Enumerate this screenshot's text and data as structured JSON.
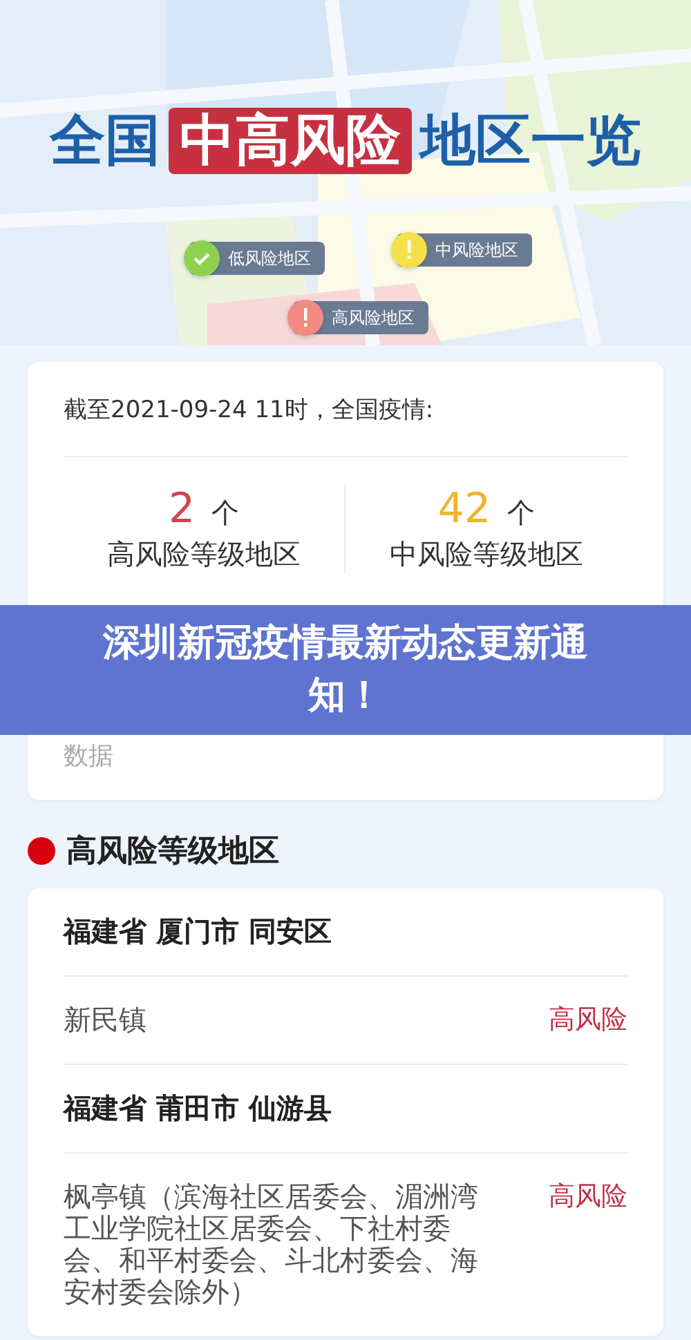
{
  "header": {
    "title_parts": [
      {
        "text": "全国",
        "highlighted": false
      },
      {
        "text": "中高风险",
        "highlighted": true
      },
      {
        "text": "地区一览",
        "highlighted": false
      }
    ],
    "legend": [
      {
        "label": "低风险地区",
        "kind": "check",
        "color": "#8fd14f"
      },
      {
        "label": "中风险地区",
        "kind": "alert",
        "color": "#f5e04a"
      },
      {
        "label": "高风险地区",
        "kind": "alert",
        "color": "#f28b82"
      }
    ]
  },
  "summary": {
    "timestamp": "截至2021-09-24 11时，全国疫情:",
    "stats": [
      {
        "count": "2",
        "unit": "个",
        "label": "高风险等级地区",
        "color": "#d0464f"
      },
      {
        "count": "42",
        "unit": "个",
        "label": "中风险等级地区",
        "color": "#f0b429"
      }
    ],
    "source": "数据"
  },
  "banner": {
    "text": "深圳新冠疫情最新动态更新通知！"
  },
  "high_risk": {
    "heading": "高风险等级地区",
    "color": "#d7000f",
    "groups": [
      {
        "region": "福建省 厦门市 同安区",
        "areas": [
          {
            "name": "新民镇",
            "level": "高风险"
          }
        ]
      },
      {
        "region": "福建省 莆田市 仙游县",
        "areas": [
          {
            "name": "枫亭镇（滨海社区居委会、湄洲湾工业学院社区居委会、下社村委会、和平村委会、斗北村委会、海安村委会除外）",
            "level": "高风险"
          }
        ]
      }
    ]
  }
}
